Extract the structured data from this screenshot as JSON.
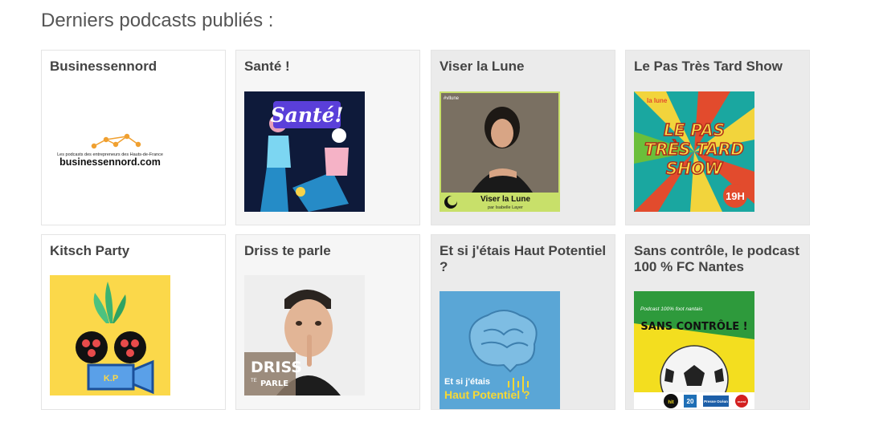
{
  "page": {
    "heading": "Derniers podcasts publiés :"
  },
  "podcasts": [
    {
      "title": "Businessennord",
      "art_tagline": "Les podcasts des entrepreneurs des Hauts-de-France",
      "art_site": "businessennord.com"
    },
    {
      "title": "Santé !",
      "art_text": "Santé!"
    },
    {
      "title": "Viser la Lune",
      "art_hashtag": "#vllune",
      "art_name": "Viser la Lune",
      "art_author": "par Isabelle Layer"
    },
    {
      "title": "Le Pas Très Tard Show",
      "art_lines": [
        "LE PAS",
        "TRÈS TARD",
        "SHOW"
      ],
      "art_badge": "la lune",
      "art_time": "19H"
    },
    {
      "title": "Kitsch Party",
      "art_label": "K.P"
    },
    {
      "title": "Driss te parle",
      "art_line1": "DRISS",
      "art_line2": "PARLE",
      "art_small": "TE"
    },
    {
      "title": "Et si j'étais Haut Potentiel ?",
      "art_line1": "Et si j'étais",
      "art_line2": "Haut Potentiel ?"
    },
    {
      "title": "Sans contrôle, le podcast 100 % FC Nantes",
      "art_top": "Podcast 100% foot nantais",
      "art_main": "SANS CONTRÔLE !",
      "art_logos": [
        "hit",
        "20",
        "Presse Océan",
        "ouest"
      ]
    }
  ],
  "colors": {
    "card_bg_default": "#f6f6f6",
    "card_bg_alt": "#ebebeb",
    "card_bg_white": "#ffffff"
  }
}
